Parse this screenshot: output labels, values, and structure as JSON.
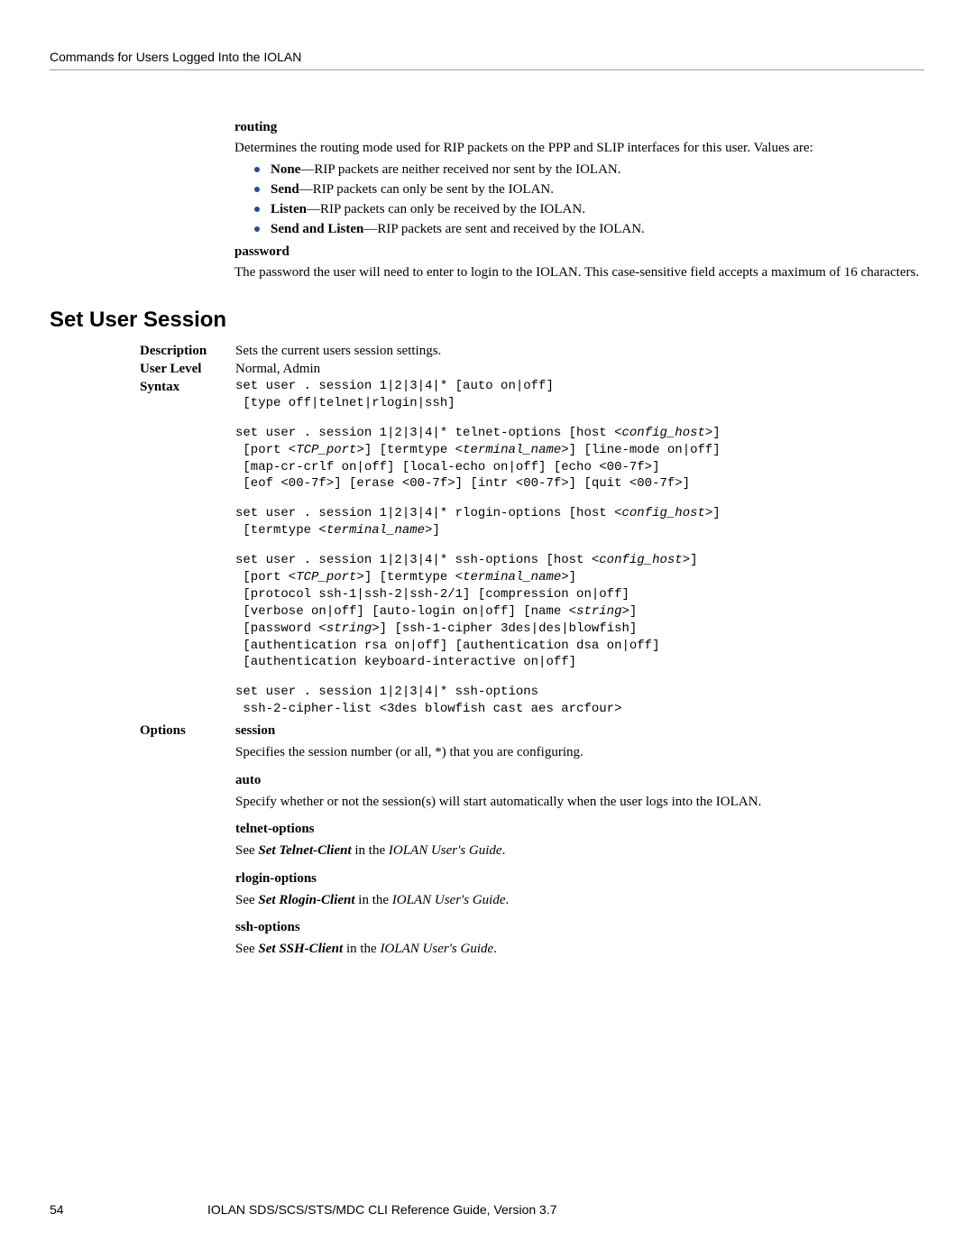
{
  "header": "Commands for Users Logged Into the IOLAN",
  "routing": {
    "title": "routing",
    "intro": "Determines the routing mode used for RIP packets on the PPP and SLIP interfaces for this user. Values are:",
    "items": {
      "none_b": "None",
      "none_t": "—RIP packets are neither received nor sent by the IOLAN.",
      "send_b": "Send",
      "send_t": "—RIP packets can only be sent by the IOLAN.",
      "listen_b": "Listen",
      "listen_t": "—RIP packets can only be received by the IOLAN.",
      "sl_b": "Send and Listen",
      "sl_t": "—RIP packets are sent and received by the IOLAN."
    }
  },
  "password": {
    "title": "password",
    "body": "The password the user will need to enter to login to the IOLAN. This case-sensitive field accepts a maximum of 16 characters."
  },
  "section_title": "Set User Session",
  "labels": {
    "description": "Description",
    "user_level": "User Level",
    "syntax": "Syntax",
    "options": "Options"
  },
  "description": "Sets the current users session settings.",
  "user_level": "Normal, Admin",
  "syntax": {
    "b1l1": "set user . session 1|2|3|4|* [auto on|off]",
    "b1l2": " [type off|telnet|rlogin|ssh]",
    "b2l1a": "set user . session 1|2|3|4|* telnet-options [host <",
    "b2l1i": "config_host",
    "b2l1b": ">]",
    "b2l2a": " [port <",
    "b2l2i1": "TCP_port",
    "b2l2b": ">] [termtype <",
    "b2l2i2": "terminal_name",
    "b2l2c": ">] [line-mode on|off]",
    "b2l3": " [map-cr-crlf on|off] [local-echo on|off] [echo <00-7f>]",
    "b2l4": " [eof <00-7f>] [erase <00-7f>] [intr <00-7f>] [quit <00-7f>]",
    "b3l1a": "set user . session 1|2|3|4|* rlogin-options [host <",
    "b3l1i": "config_host",
    "b3l1b": ">]",
    "b3l2a": " [termtype <",
    "b3l2i": "terminal_name",
    "b3l2b": ">]",
    "b4l1a": "set user . session 1|2|3|4|* ssh-options [host <",
    "b4l1i": "config_host",
    "b4l1b": ">]",
    "b4l2a": " [port <",
    "b4l2i1": "TCP_port",
    "b4l2b": ">] [termtype <",
    "b4l2i2": "terminal_name",
    "b4l2c": ">]",
    "b4l3": " [protocol ssh-1|ssh-2|ssh-2/1] [compression on|off]",
    "b4l4a": " [verbose on|off] [auto-login on|off] [name <",
    "b4l4i": "string",
    "b4l4b": ">]",
    "b4l5a": " [password <",
    "b4l5i": "string",
    "b4l5b": ">] [ssh-1-cipher 3des|des|blowfish]",
    "b4l6": " [authentication rsa on|off] [authentication dsa on|off]",
    "b4l7": " [authentication keyboard-interactive on|off]",
    "b5l1": "set user . session 1|2|3|4|* ssh-options",
    "b5l2": " ssh-2-cipher-list <3des blowfish cast aes arcfour>"
  },
  "options": {
    "session_t": "session",
    "session_b": "Specifies the session number (or all, *) that you are configuring.",
    "auto_t": "auto",
    "auto_b": "Specify whether or not the session(s) will start automatically when the user logs into the IOLAN.",
    "telnet_t": "telnet-options",
    "telnet_s": "See ",
    "telnet_bi": "Set Telnet-Client",
    "telnet_m": " in the ",
    "telnet_i": "IOLAN User's Guide",
    "rlogin_t": "rlogin-options",
    "rlogin_s": "See ",
    "rlogin_bi": "Set Rlogin-Client",
    "rlogin_m": " in the ",
    "rlogin_i": "IOLAN User's Guide",
    "ssh_t": "ssh-options",
    "ssh_s": "See ",
    "ssh_bi": "Set SSH-Client",
    "ssh_m": " in the ",
    "ssh_i": "IOLAN User's Guide",
    "period": "."
  },
  "footer": {
    "page": "54",
    "title": "IOLAN SDS/SCS/STS/MDC CLI Reference Guide, Version 3.7"
  }
}
